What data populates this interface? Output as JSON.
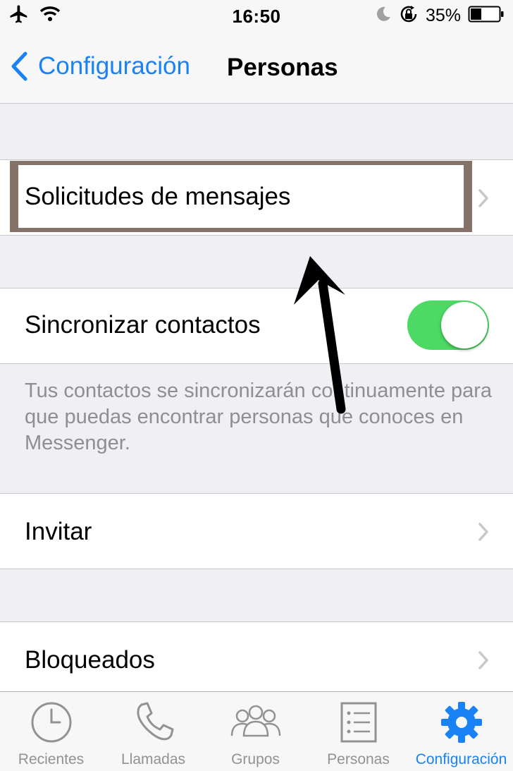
{
  "status_bar": {
    "time": "16:50",
    "battery_percent": "35%",
    "icons": [
      "airplane-icon",
      "wifi-icon",
      "moon-icon",
      "rotation-lock-icon",
      "battery-icon"
    ]
  },
  "nav": {
    "back_label": "Configuración",
    "title": "Personas"
  },
  "rows": {
    "message_requests": "Solicitudes de mensajes",
    "sync_contacts": "Sincronizar contactos",
    "sync_footnote": "Tus contactos se sincronizarán continuamente para que puedas encontrar personas que conoces en Messenger.",
    "invite": "Invitar",
    "blocked": "Bloqueados"
  },
  "sync_toggle_on": true,
  "tabs": [
    {
      "label": "Recientes",
      "icon": "clock-icon"
    },
    {
      "label": "Llamadas",
      "icon": "phone-icon"
    },
    {
      "label": "Grupos",
      "icon": "group-icon"
    },
    {
      "label": "Personas",
      "icon": "list-icon"
    },
    {
      "label": "Configuración",
      "icon": "gear-icon",
      "active": true
    }
  ],
  "colors": {
    "accent": "#1a82f7",
    "toggle_on": "#4cd964",
    "background": "#efeff4",
    "highlight": "#857269"
  }
}
